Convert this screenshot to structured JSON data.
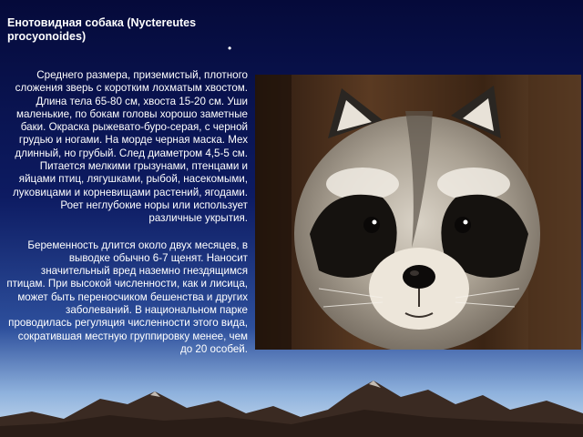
{
  "slide": {
    "title": "Енотовидная собака (Nyctereutes procyonoides)",
    "bullet": "•",
    "paragraphs": [
      "Среднего размера, приземистый, плотного сложения зверь с коротким лохматым хвостом. Длина тела 65-80 см, хвоста 15-20 см. Уши маленькие, по бокам головы хорошо заметные баки. Окраска рыжевато-буро-серая, с черной грудью и ногами. На морде черная маска. Мех длинный, но грубый. След диаметром 4,5-5 см. Питается мелкими грызунами, птенцами и яйцами птиц, лягушками, рыбой, насекомыми, луковицами и корневищами растений, ягодами. Роет неглубокие норы или использует различные укрытия.",
      "Беременность длится около двух месяцев, в выводке обычно 6-7 щенят. Наносит значительный вред наземно гнездящимся птицам. При высокой численности, как и лисица, может быть переносчиком бешенства и других заболеваний. В национальном парке проводилась регуляция численности этого вида, сократившая местную группировку менее, чем до 20 особей."
    ]
  },
  "colors": {
    "background_top": "#050a3a",
    "background_bottom": "#c9dcef",
    "text": "#ffffff",
    "mountain": "#3a2a22"
  }
}
